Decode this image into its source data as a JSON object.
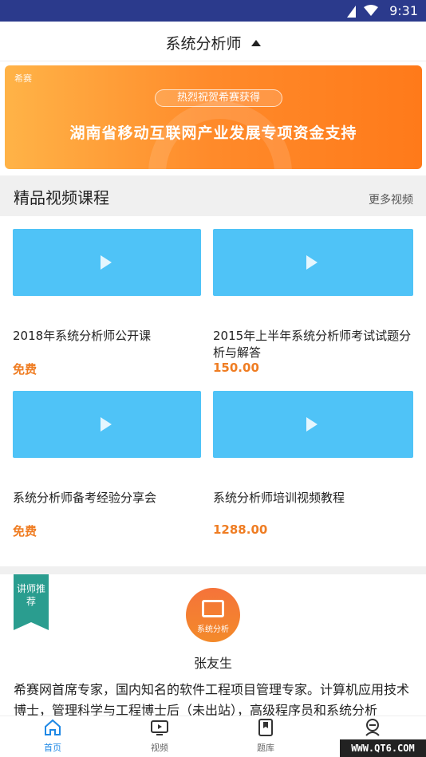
{
  "status_bar": {
    "time": "9:31"
  },
  "top_bar": {
    "title": "系统分析师"
  },
  "banner": {
    "logo": "希赛",
    "pill_text": "热烈祝贺希赛获得",
    "headline": "湖南省移动互联网产业发展专项资金支持"
  },
  "section": {
    "title": "精品视频课程",
    "more": "更多视频"
  },
  "courses": [
    {
      "name": "2018年系统分析师公开课",
      "price": "免费"
    },
    {
      "name": "2015年上半年系统分析师考试试题分析与解答",
      "price": "150.00"
    },
    {
      "name": "系统分析师备考经验分享会",
      "price": "免费"
    },
    {
      "name": "系统分析师培训视频教程",
      "price": "1288.00"
    }
  ],
  "teacher": {
    "ribbon": "讲师推荐",
    "avatar_caption": "系统分析",
    "name": "张友生",
    "description": "希赛网首席专家，国内知名的软件工程项目管理专家。计算机应用技术博士，管理科学与工程博士后（未出站），高级程序员和系统分析"
  },
  "tabs": [
    {
      "label": "首页",
      "icon": "home-icon",
      "active": true
    },
    {
      "label": "视频",
      "icon": "tv-icon",
      "active": false
    },
    {
      "label": "题库",
      "icon": "bookmark-icon",
      "active": false
    },
    {
      "label": "",
      "icon": "user-icon",
      "active": false
    }
  ],
  "watermark": "WWW.QT6.COM",
  "colors": {
    "accent": "#ef7d23",
    "tab_active": "#1e88e5",
    "thumb": "#4fc3f7",
    "status_bar": "#2b3a8c"
  }
}
